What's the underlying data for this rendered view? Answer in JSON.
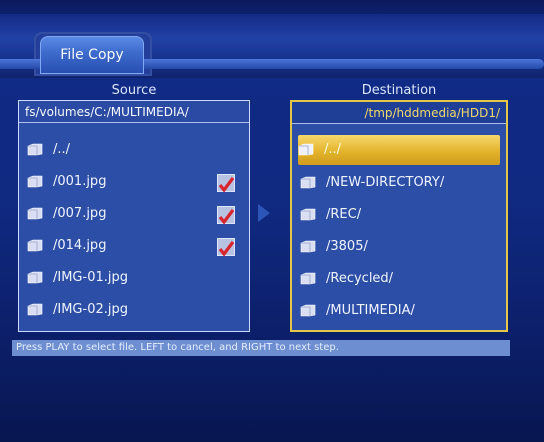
{
  "header": {
    "tab_title": "File Copy"
  },
  "source": {
    "title": "Source",
    "path": "fs/volumes/C:/MULTIMEDIA/",
    "items": [
      {
        "label": "/../",
        "checked": false
      },
      {
        "label": "/001.jpg",
        "checked": true
      },
      {
        "label": "/007.jpg",
        "checked": true
      },
      {
        "label": "/014.jpg",
        "checked": true
      },
      {
        "label": "/IMG-01.jpg",
        "checked": false
      },
      {
        "label": "/IMG-02.jpg",
        "checked": false
      }
    ]
  },
  "destination": {
    "title": "Destination",
    "path": "/tmp/hddmedia/HDD1/",
    "items": [
      {
        "label": "/../",
        "selected": true
      },
      {
        "label": "/NEW-DIRECTORY/"
      },
      {
        "label": "/REC/"
      },
      {
        "label": "/3805/"
      },
      {
        "label": "/Recycled/"
      },
      {
        "label": "/MULTIMEDIA/"
      }
    ]
  },
  "hint": "Press PLAY to select file. LEFT to cancel, and RIGHT to next step.",
  "colors": {
    "background": "#102a82",
    "selection": "#e4b42c",
    "checkmark": "#d8242a",
    "destination_border": "#e2c74a"
  },
  "icons": {
    "folder": "folder-icon",
    "parent": "parent-folder-icon",
    "check": "checkbox-checked-icon",
    "arrow": "right-arrow-icon"
  }
}
